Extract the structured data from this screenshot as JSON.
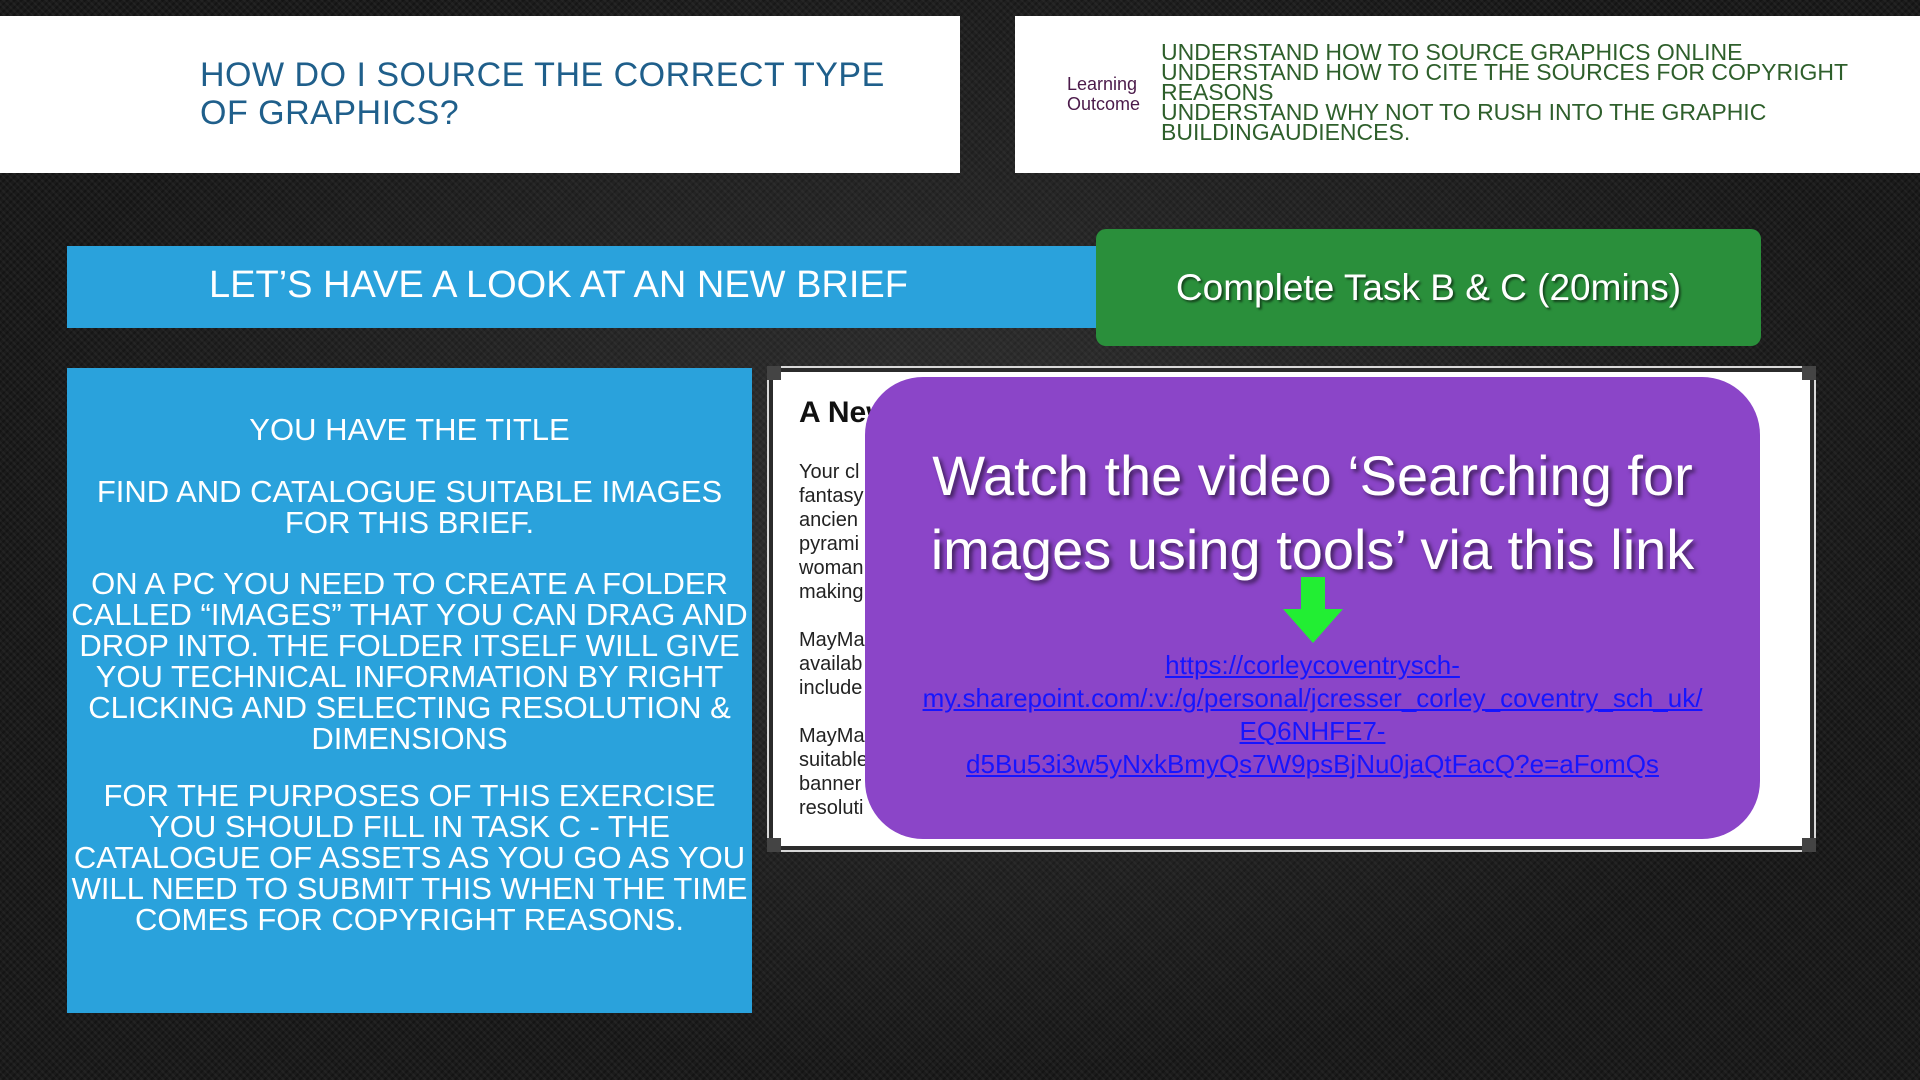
{
  "header": {
    "title_line1": "HOW DO I SOURCE THE CORRECT TYPE",
    "title_line2": "OF GRAPHICS?"
  },
  "learning_outcome": {
    "label_line1": "Learning",
    "label_line2": "Outcome",
    "items": [
      "UNDERSTAND HOW TO SOURCE GRAPHICS ONLINE",
      "UNDERSTAND HOW TO CITE THE SOURCES FOR COPYRIGHT",
      "REASONS",
      "UNDERSTAND WHY NOT TO RUSH INTO THE GRAPHIC",
      "BUILDINGAUDIENCES."
    ]
  },
  "banner": {
    "brief_label": "LET’S HAVE A LOOK AT AN NEW BRIEF",
    "task_button": "Complete Task B & C (20mins)"
  },
  "instructions": {
    "p1": "YOU HAVE THE TITLE",
    "p2": "FIND AND CATALOGUE SUITABLE IMAGES FOR THIS BRIEF.",
    "p3": "ON A PC YOU NEED TO CREATE A FOLDER CALLED “IMAGES” THAT YOU CAN DRAG AND DROP INTO. THE FOLDER ITSELF WILL GIVE YOU TECHNICAL INFORMATION BY RIGHT CLICKING AND SELECTING RESOLUTION & DIMENSIONS",
    "p4": "FOR THE PURPOSES OF THIS EXERCISE YOU SHOULD FILL IN TASK C - THE CATALOGUE OF ASSETS AS YOU GO AS YOU WILL NEED TO SUBMIT THIS WHEN THE TIME COMES FOR COPYRIGHT REASONS."
  },
  "document_preview": {
    "heading": "A New",
    "lines": [
      "Your cl",
      "fantasy",
      "ancien",
      "pyrami",
      "woman",
      "making",
      "",
      "MayMa",
      "availab",
      "include",
      "",
      "MayMa",
      "suitable",
      "banner",
      "resoluti"
    ]
  },
  "video_card": {
    "title_line1": "Watch the video ‘Searching for",
    "title_line2": "images using tools’ via this link",
    "link_line1": "https://corleycoventrysch-",
    "link_line2": "my.sharepoint.com/:v:/g/personal/jcresser_corley_coventry_sch_uk/",
    "link_line3": "EQ6NHFE7-",
    "link_line4": "d5Bu53i3w5yNxkBmyQs7W9psBjNu0jaQtFacQ?e=aFomQs",
    "arrow_color": "#22ee33"
  }
}
